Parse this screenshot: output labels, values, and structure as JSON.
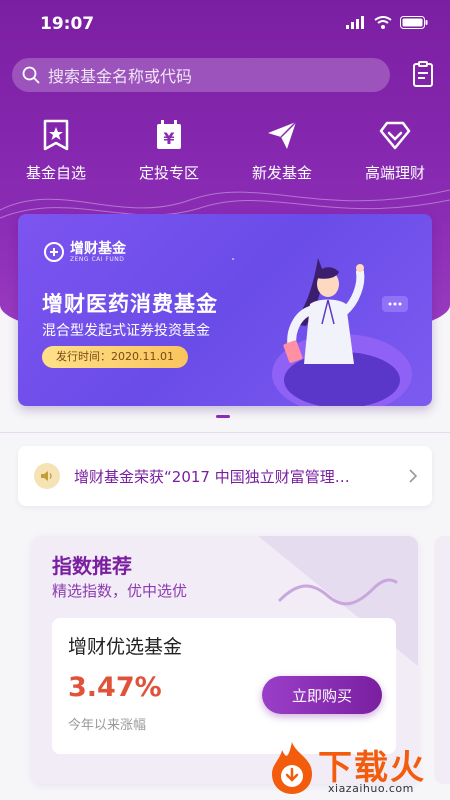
{
  "status": {
    "time": "19:07"
  },
  "search": {
    "placeholder": "搜索基金名称或代码"
  },
  "quick_nav": [
    {
      "label": "基金自选",
      "icon": "bookmark-star-icon"
    },
    {
      "label": "定投专区",
      "icon": "yen-calendar-icon"
    },
    {
      "label": "新发基金",
      "icon": "paper-plane-icon"
    },
    {
      "label": "高端理财",
      "icon": "diamond-icon"
    }
  ],
  "banner": {
    "logo_name": "增财基金",
    "logo_sub": "ZENG CAI FUND",
    "title": "增财医药消费基金",
    "subtitle": "混合型发起式证券投资基金",
    "date_label": "发行时间：2020.11.01",
    "page_count": 1,
    "active_page": 1
  },
  "notice": {
    "text": "增财基金荣获“2017 中国独立财富管理…"
  },
  "index_card": {
    "title": "指数推荐",
    "subtitle": "精选指数，优中选优",
    "fund_name": "增财优选基金",
    "rate": "3.47%",
    "rate_label": "今年以来涨幅",
    "buy_label": "立即购买"
  },
  "watermark": {
    "text": "下载火",
    "url": "xiazaihuo.com"
  },
  "colors": {
    "primary": "#7a1fa0",
    "rate": "#e0533a",
    "banner": "#6a4ce8"
  }
}
